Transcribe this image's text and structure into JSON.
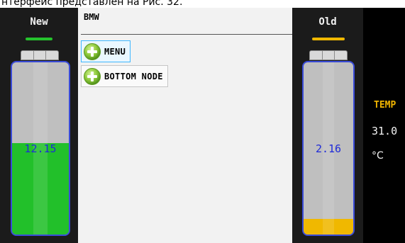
{
  "caption": "нтерфейс представлен на Рис. 32.",
  "left_battery": {
    "label": "New",
    "value": "12.15",
    "fill_fraction": 0.53,
    "fill_color": "#22c02a",
    "indicator_color": "#25c32d"
  },
  "tree": {
    "title": "BMW",
    "nodes": [
      {
        "label": "MENU",
        "icon": "plus-circle-icon",
        "selected": true
      },
      {
        "label": "BOTTOM NODE",
        "icon": "plus-circle-icon",
        "selected": false
      }
    ]
  },
  "right_battery": {
    "label": "Old",
    "value": "2.16",
    "fill_fraction": 0.09,
    "fill_color": "#f0b800",
    "indicator_color": "#f0b800"
  },
  "temperature": {
    "label": "TEMP",
    "value": "31.0",
    "unit": "°C",
    "label_color": "#f0b400"
  },
  "colors": {
    "battery_border": "#3a4bd8",
    "battery_value_text": "#1f2bd8",
    "battery_empty": "#bfbfbf"
  }
}
